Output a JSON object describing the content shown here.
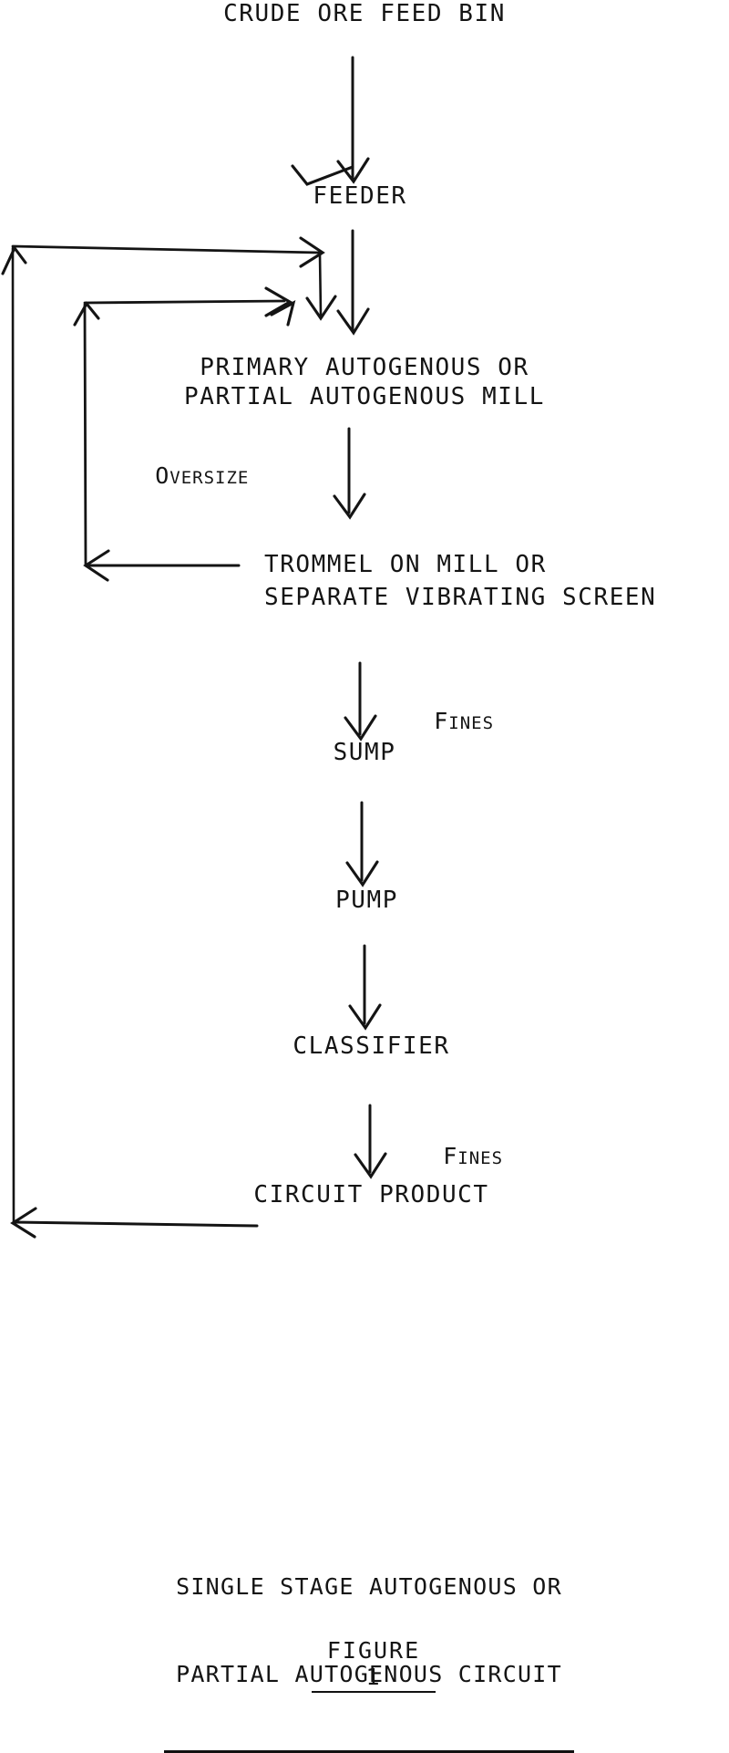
{
  "figure": {
    "title_line1": "SINGLE STAGE AUTOGENOUS OR",
    "title_line2": "PARTIAL AUTOGENOUS CIRCUIT",
    "figure_label": "FIGURE 1"
  },
  "nodes": {
    "crude_ore_feed_bin": "CRUDE ORE FEED BIN",
    "feeder": "FEEDER",
    "mill_line1": "PRIMARY AUTOGENOUS OR",
    "mill_line2": "PARTIAL AUTOGENOUS MILL",
    "screen_line1": "TROMMEL ON MILL OR",
    "screen_line2": "SEPARATE VIBRATING SCREEN",
    "sump": "SUMP",
    "pump": "PUMP",
    "classifier": "CLASSIFIER",
    "circuit_product": "CIRCUIT PRODUCT"
  },
  "stream_labels": {
    "oversize": {
      "first": "O",
      "rest": "VERSIZE"
    },
    "screen_fines": {
      "first": "F",
      "rest": "INES"
    },
    "classifier_fines": {
      "first": "F",
      "rest": "INES"
    }
  },
  "flows": [
    {
      "from": "crude_ore_feed_bin",
      "to": "feeder",
      "label": ""
    },
    {
      "from": "feeder",
      "to": "mill",
      "label": ""
    },
    {
      "from": "mill",
      "to": "screen",
      "label": ""
    },
    {
      "from": "screen",
      "to": "mill",
      "label": "Oversize"
    },
    {
      "from": "screen",
      "to": "sump",
      "label": "Fines"
    },
    {
      "from": "sump",
      "to": "pump",
      "label": ""
    },
    {
      "from": "pump",
      "to": "classifier",
      "label": ""
    },
    {
      "from": "classifier",
      "to": "feeder",
      "label": ""
    },
    {
      "from": "classifier",
      "to": "circuit_product",
      "label": "Fines"
    }
  ],
  "style": {
    "ink": "#141414",
    "paper": "#ffffff"
  }
}
